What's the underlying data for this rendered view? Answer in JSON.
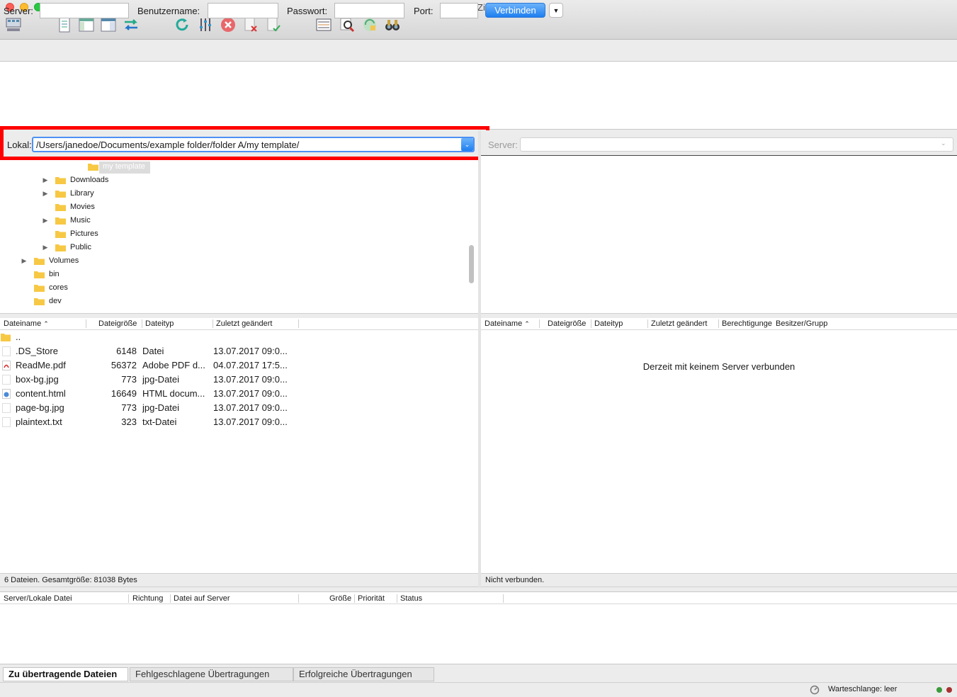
{
  "window": {
    "title": "FileZilla"
  },
  "toolbar": {
    "buttons": [
      {
        "icon": "site-manager-icon"
      },
      {
        "icon": "toggle-log-icon"
      },
      {
        "icon": "toggle-tree-icon"
      },
      {
        "icon": "toggle-queue-icon"
      },
      {
        "icon": "sync-arrows-icon"
      },
      {
        "icon": "refresh-icon"
      },
      {
        "icon": "filter-icon"
      },
      {
        "icon": "cancel-icon"
      },
      {
        "icon": "disconnect-icon"
      },
      {
        "icon": "reconnect-icon"
      },
      {
        "icon": "compare-icon"
      },
      {
        "icon": "search-icon"
      },
      {
        "icon": "sync-browse-icon"
      },
      {
        "icon": "binoculars-icon"
      }
    ]
  },
  "quickconnect": {
    "server_label": "Server:",
    "user_label": "Benutzername:",
    "pass_label": "Passwort:",
    "port_label": "Port:",
    "server_value": "",
    "user_value": "",
    "pass_value": "",
    "port_value": "",
    "connect_label": "Verbinden"
  },
  "local": {
    "label": "Lokal:",
    "path": "/Users/janedoe/Documents/example folder/folder A/my template/",
    "tree": [
      {
        "label": "my template",
        "selected": true,
        "expandable": false
      },
      {
        "label": "Downloads",
        "expandable": true
      },
      {
        "label": "Library",
        "expandable": true
      },
      {
        "label": "Movies",
        "expandable": false
      },
      {
        "label": "Music",
        "expandable": true
      },
      {
        "label": "Pictures",
        "expandable": false
      },
      {
        "label": "Public",
        "expandable": true
      },
      {
        "label": "Volumes",
        "expandable": true
      },
      {
        "label": "bin",
        "expandable": false
      },
      {
        "label": "cores",
        "expandable": false
      },
      {
        "label": "dev",
        "expandable": false
      }
    ],
    "columns": {
      "name": "Dateiname",
      "size": "Dateigröße",
      "type": "Dateityp",
      "modified": "Zuletzt geändert"
    },
    "files": [
      {
        "name": "..",
        "size": "",
        "type": "",
        "modified": "",
        "icon": "folder-icon"
      },
      {
        "name": ".DS_Store",
        "size": "6148",
        "type": "Datei",
        "modified": "13.07.2017 09:0...",
        "icon": "file-icon"
      },
      {
        "name": "ReadMe.pdf",
        "size": "56372",
        "type": "Adobe PDF d...",
        "modified": "04.07.2017 17:5...",
        "icon": "pdf-icon"
      },
      {
        "name": "box-bg.jpg",
        "size": "773",
        "type": "jpg-Datei",
        "modified": "13.07.2017 09:0...",
        "icon": "file-icon"
      },
      {
        "name": "content.html",
        "size": "16649",
        "type": "HTML docum...",
        "modified": "13.07.2017 09:0...",
        "icon": "html-icon"
      },
      {
        "name": "page-bg.jpg",
        "size": "773",
        "type": "jpg-Datei",
        "modified": "13.07.2017 09:0...",
        "icon": "file-icon"
      },
      {
        "name": "plaintext.txt",
        "size": "323",
        "type": "txt-Datei",
        "modified": "13.07.2017 09:0...",
        "icon": "file-icon"
      }
    ],
    "status": "6 Dateien. Gesamtgröße: 81038 Bytes"
  },
  "remote": {
    "label": "Server:",
    "path": "",
    "columns": {
      "name": "Dateiname",
      "size": "Dateigröße",
      "type": "Dateityp",
      "modified": "Zuletzt geändert",
      "perms": "Berechtigunge",
      "owner": "Besitzer/Grupp"
    },
    "empty_message": "Derzeit mit keinem Server verbunden",
    "status": "Nicht verbunden."
  },
  "queue": {
    "columns": {
      "file": "Server/Lokale Datei",
      "direction": "Richtung",
      "remote": "Datei auf Server",
      "size": "Größe",
      "priority": "Priorität",
      "status": "Status"
    },
    "tabs": [
      {
        "label": "Zu übertragende Dateien",
        "active": true
      },
      {
        "label": "Fehlgeschlagene Übertragungen",
        "active": false
      },
      {
        "label": "Erfolgreiche Übertragungen",
        "active": false
      }
    ],
    "queue_status": "Warteschlange: leer"
  },
  "colors": {
    "accent": "#1f7ff0",
    "highlight": "#ff0000",
    "folder": "#f7c844"
  }
}
